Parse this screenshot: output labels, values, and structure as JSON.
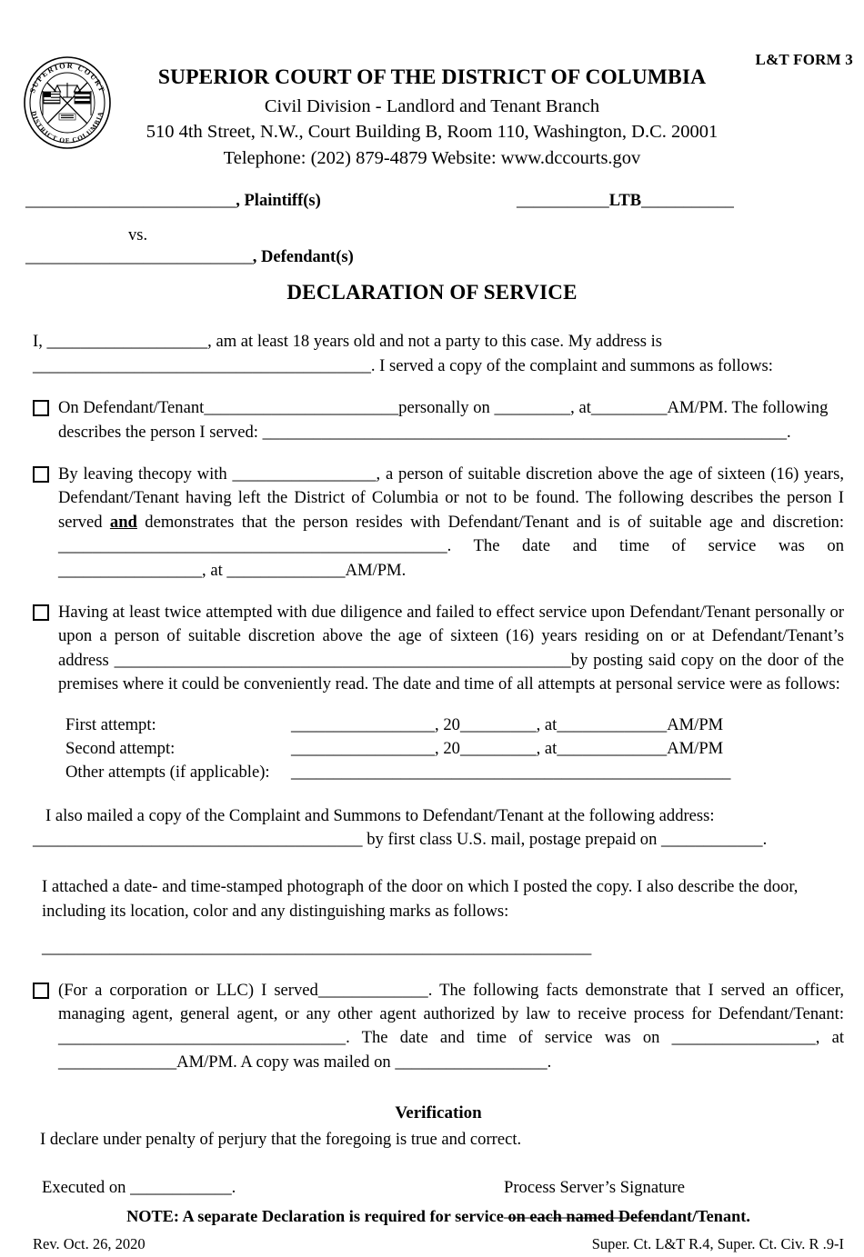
{
  "form_number": "L&T FORM 3",
  "seal": {
    "top_text": "SUPERIOR COURT",
    "bottom_text": "DISTRICT OF COLUMBIA"
  },
  "header": {
    "court_title": "SUPERIOR COURT OF THE DISTRICT OF COLUMBIA",
    "division": "Civil Division - Landlord and Tenant Branch",
    "address": "510 4th Street, N.W., Court Building B, Room 110, Washington, D.C. 20001",
    "contact": "Telephone: (202) 879-4879 Website: www.dccourts.gov"
  },
  "caption": {
    "plaintiff_blank": "_________________________",
    "plaintiff_label": ", Plaintiff(s)",
    "case_prefix": "___________",
    "case_label": "LTB",
    "case_suffix": "___________",
    "vs": "vs.",
    "defendant_blank": "___________________________",
    "defendant_label": ", Defendant(s)"
  },
  "doc_title": "DECLARATION OF SERVICE",
  "intro": {
    "line1_a": "I, ",
    "line1_blank": "___________________",
    "line1_b": ", am at least 18 years old and not a party to this case.  My address is",
    "line2_blank": "________________________________________",
    "line2_b": ".  I served a copy of the complaint and summons as follows:"
  },
  "items": [
    {
      "id": "personal-service",
      "parts": [
        "On Defendant/Tenant",
        "_______________________",
        "personally on ",
        "_________",
        ", at",
        "_________",
        "AM/PM. The following describes the person I served: ",
        "______________________________________________________________",
        "."
      ]
    },
    {
      "id": "substituted-service",
      "text_a": "By leaving the",
      "text_b": "copy with ",
      "blank_1": "_________________",
      "text_c": ", a person of suitable discretion above the age of sixteen (16) years, Defendant/Tenant having left the District of Columbia or not to be found. The following describes the person I served ",
      "emphasis": "and",
      "text_d": " demonstrates that the person resides with Defendant/Tenant and is of suitable age and discretion: ",
      "blank_2": "______________________________________________",
      "text_e": ". The date and time of service was on ",
      "blank_3": "_________________",
      "text_f": ", at ",
      "blank_4": "______________",
      "text_g": "AM/PM."
    },
    {
      "id": "posting-service",
      "text_a": "Having at least twice attempted with due diligence and failed to effect service upon Defendant/Tenant personally or upon a person of suitable discretion above the age of sixteen (16) years residing on or at Defendant/Tenant’s address ",
      "blank_1": "______________________________________________________",
      "text_b": "by posting said copy on the door of the premises where it could be conveniently read. The date and time of all attempts at personal service were as follows:"
    }
  ],
  "attempts": [
    {
      "label": "First attempt:",
      "blank_date": "_________________",
      "year_prefix": ", 20",
      "year_blank": "_________",
      "at": ", at ",
      "time_blank": "_____________",
      "ampm": "AM/PM"
    },
    {
      "label": "Second attempt:",
      "blank_date": "_________________",
      "year_prefix": ", 20",
      "year_blank": "_________",
      "at": ", at ",
      "time_blank": "_____________",
      "ampm": "AM/PM"
    },
    {
      "label": "Other attempts (if applicable):",
      "blank_date": "____________________________________________________",
      "year_prefix": "",
      "year_blank": "",
      "at": "",
      "time_blank": "",
      "ampm": ""
    }
  ],
  "mailed": {
    "line1": "I also mailed a copy of the Complaint and Summons to Defendant/Tenant at the following address:",
    "line2_blank": "_______________________________________",
    "line2_text": " by first class U.S. mail, postage prepaid on ",
    "line2_blank2": "____________",
    "line2_end": "."
  },
  "photo": {
    "line1": "I attached a date- and time-stamped photograph of the door on which I posted the copy. I also describe",
    "line2": "the door, including its location, color and any distinguishing marks as follows:",
    "rule": "_________________________________________________________________"
  },
  "corporation": {
    "text_a": "(For a corporation or LLC)",
    "text_b": " I served",
    "blank_1": "_____________",
    "text_c": ". The following facts demonstrate that I served an officer, managing agent, general agent, or any other agent authorized by law to receive process for Defendant/Tenant: ",
    "blank_2": "__________________________________",
    "text_d": ". The date and time of service was on ",
    "blank_3": "_________________",
    "text_e": ", at ",
    "blank_4": "______________",
    "text_f": "AM/PM. A copy was mailed on ",
    "blank_5": "__________________",
    "text_g": "."
  },
  "verification": {
    "heading": "Verification",
    "declaration": "I declare under penalty of perjury that the foregoing is true and correct.",
    "executed_label": "Executed on ",
    "executed_blank": "____________",
    "executed_end": ".",
    "signature_label": "Process Server’s Signature ",
    "signature_blank": "__________________",
    "signature_end": "."
  },
  "note": "NOTE: A separate Declaration is required for service on each named Defendant/Tenant.",
  "footer": {
    "revision": "Rev. Oct. 26, 2020",
    "citation": "Super. Ct. L&T R.4, Super. Ct. Civ. R .9-I"
  }
}
